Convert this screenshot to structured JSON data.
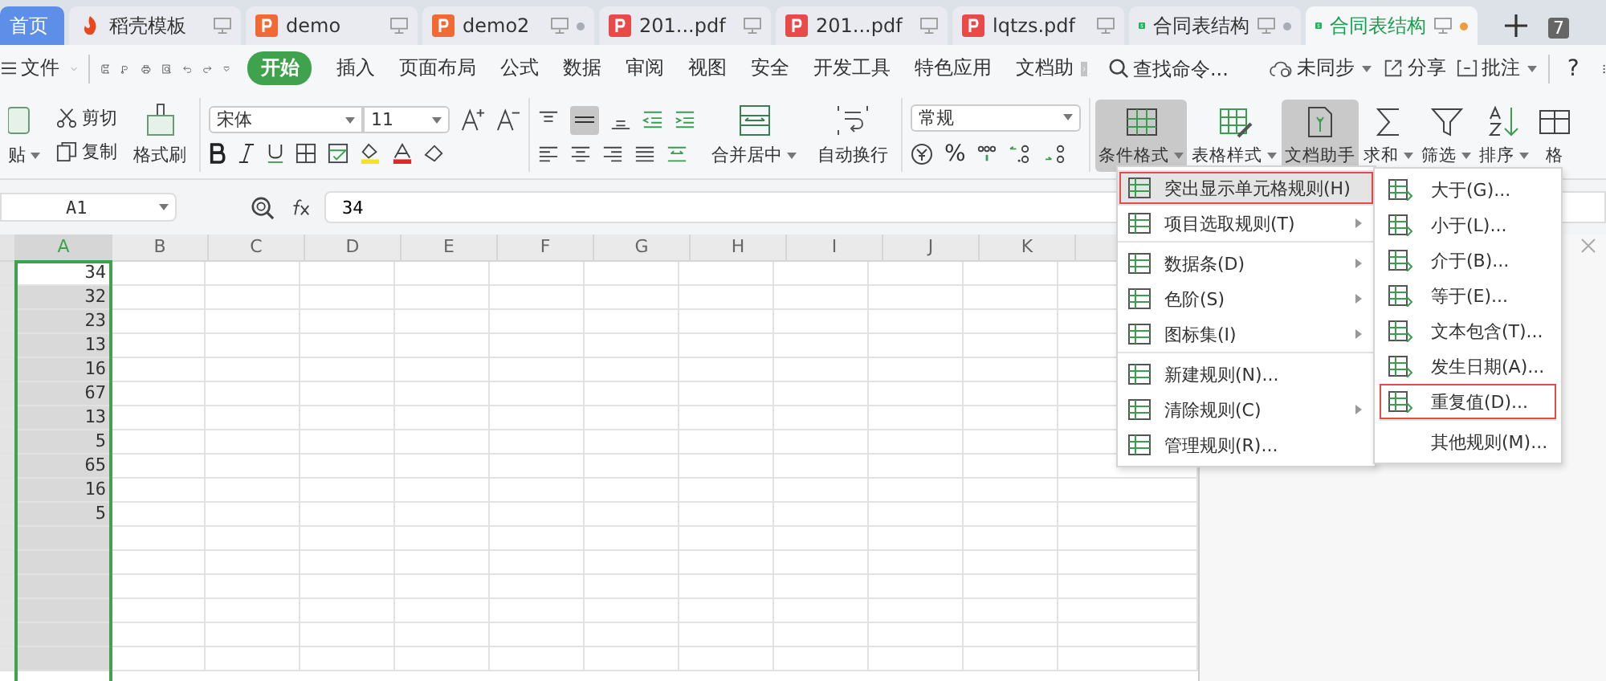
{
  "tabs": [
    {
      "label": "首页",
      "kind": "home",
      "selected": true,
      "dot": false
    },
    {
      "label": "稻壳模板",
      "kind": "docer",
      "selected": false,
      "dot": false
    },
    {
      "label": "demo",
      "kind": "ppt",
      "selected": false,
      "dot": false
    },
    {
      "label": "demo2",
      "kind": "ppt",
      "selected": false,
      "dot": true
    },
    {
      "label": "201...pdf",
      "kind": "pdf",
      "selected": false,
      "dot": false
    },
    {
      "label": "201...pdf",
      "kind": "pdf",
      "selected": false,
      "dot": false
    },
    {
      "label": "lqtzs.pdf",
      "kind": "pdf",
      "selected": false,
      "dot": false
    },
    {
      "label": "合同表结构",
      "kind": "sheet",
      "selected": false,
      "dot": true
    },
    {
      "label": "合同表结构",
      "kind": "sheet",
      "selected": true,
      "dot": true
    }
  ],
  "tab_count": "7",
  "menu": {
    "file": "文件",
    "tabs": [
      {
        "label": "开始",
        "selected": true
      },
      {
        "label": "插入",
        "selected": false
      },
      {
        "label": "页面布局",
        "selected": false
      },
      {
        "label": "公式",
        "selected": false
      },
      {
        "label": "数据",
        "selected": false
      },
      {
        "label": "审阅",
        "selected": false
      },
      {
        "label": "视图",
        "selected": false
      },
      {
        "label": "安全",
        "selected": false
      },
      {
        "label": "开发工具",
        "selected": false
      },
      {
        "label": "特色应用",
        "selected": false
      },
      {
        "label": "文档助",
        "selected": false
      }
    ],
    "search": {
      "placeholder": "查找命令..."
    },
    "sync": "未同步",
    "share": "分享",
    "comment": "批注",
    "help": "?"
  },
  "ribbon": {
    "paste": "贴",
    "cut": "剪切",
    "copy": "复制",
    "format_painter": "格式刷",
    "font": {
      "name": "宋体",
      "size": "11"
    },
    "merge": "合并居中",
    "wrap": "自动换行",
    "number_format": "常规",
    "percent": "%",
    "tools": [
      {
        "label": "条件格式",
        "kind": "cond",
        "selected": true,
        "dropdown": true
      },
      {
        "label": "表格样式",
        "kind": "style",
        "selected": false,
        "dropdown": true
      },
      {
        "label": "文档助手",
        "kind": "assist",
        "selected": true,
        "dropdown": false
      },
      {
        "label": "求和",
        "kind": "sum",
        "selected": false,
        "dropdown": true
      },
      {
        "label": "筛选",
        "kind": "filter",
        "selected": false,
        "dropdown": true
      },
      {
        "label": "排序",
        "kind": "sort",
        "selected": false,
        "dropdown": true
      },
      {
        "label": "格",
        "kind": "grid",
        "selected": false,
        "dropdown": false
      }
    ]
  },
  "formula_bar": {
    "cell": "A1",
    "value": "34"
  },
  "sheet": {
    "columns": [
      {
        "label": "A",
        "selected": true
      },
      {
        "label": "B",
        "selected": false
      },
      {
        "label": "C",
        "selected": false
      },
      {
        "label": "D",
        "selected": false
      },
      {
        "label": "E",
        "selected": false
      },
      {
        "label": "F",
        "selected": false
      },
      {
        "label": "G",
        "selected": false
      },
      {
        "label": "H",
        "selected": false
      },
      {
        "label": "I",
        "selected": false
      },
      {
        "label": "J",
        "selected": false
      },
      {
        "label": "K",
        "selected": false
      }
    ],
    "cells": [
      "34",
      "32",
      "23",
      "13",
      "16",
      "67",
      "13",
      "5",
      "65",
      "16",
      "5"
    ]
  },
  "context_menu": {
    "items": [
      {
        "label": "突出显示单元格规则(H)",
        "submenu": true,
        "selected": true,
        "highlighted": true,
        "separator_before": false
      },
      {
        "label": "项目选取规则(T)",
        "submenu": true,
        "selected": false,
        "highlighted": false,
        "separator_before": false
      },
      {
        "label": "数据条(D)",
        "submenu": true,
        "selected": false,
        "highlighted": false,
        "separator_before": true
      },
      {
        "label": "色阶(S)",
        "submenu": true,
        "selected": false,
        "highlighted": false,
        "separator_before": false
      },
      {
        "label": "图标集(I)",
        "submenu": true,
        "selected": false,
        "highlighted": false,
        "separator_before": false
      },
      {
        "label": "新建规则(N)...",
        "submenu": false,
        "selected": false,
        "highlighted": false,
        "separator_before": true
      },
      {
        "label": "清除规则(C)",
        "submenu": true,
        "selected": false,
        "highlighted": false,
        "separator_before": false
      },
      {
        "label": "管理规则(R)...",
        "submenu": false,
        "selected": false,
        "highlighted": false,
        "separator_before": false
      }
    ],
    "submenu": [
      {
        "label": "大于(G)...",
        "icon": true,
        "highlighted": false,
        "separator_before": false
      },
      {
        "label": "小于(L)...",
        "icon": true,
        "highlighted": false,
        "separator_before": false
      },
      {
        "label": "介于(B)...",
        "icon": true,
        "highlighted": false,
        "separator_before": false
      },
      {
        "label": "等于(E)...",
        "icon": true,
        "highlighted": false,
        "separator_before": false
      },
      {
        "label": "文本包含(T)...",
        "icon": true,
        "highlighted": false,
        "separator_before": false
      },
      {
        "label": "发生日期(A)...",
        "icon": true,
        "highlighted": false,
        "separator_before": false
      },
      {
        "label": "重复值(D)...",
        "icon": true,
        "highlighted": true,
        "separator_before": false
      },
      {
        "label": "其他规则(M)...",
        "icon": false,
        "highlighted": false,
        "separator_before": true
      }
    ]
  }
}
